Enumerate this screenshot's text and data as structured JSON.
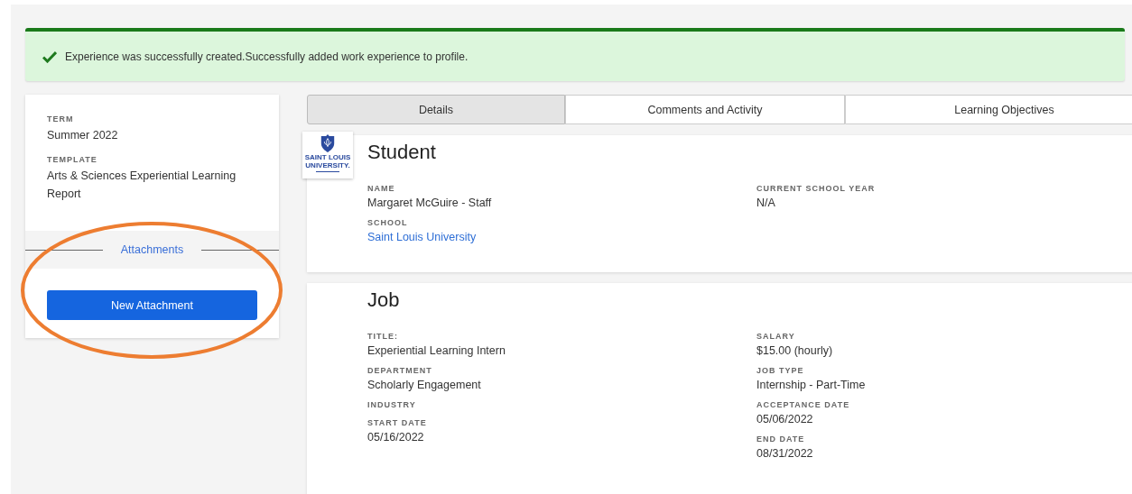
{
  "alert": {
    "kind": "success",
    "message": "Experience was successfully created.Successfully added work experience to profile."
  },
  "sidebar": {
    "fields": [
      {
        "label": "TERM",
        "value": "Summer 2022"
      },
      {
        "label": "TEMPLATE",
        "value": "Arts & Sciences Experiential Learning Report"
      }
    ],
    "section_title": "Attachments",
    "button": "New Attachment"
  },
  "annotation": {
    "kind": "ellipse",
    "color": "#ed7d31"
  },
  "tabs": [
    {
      "label": "Details",
      "selected": true
    },
    {
      "label": "Comments and Activity",
      "selected": false
    },
    {
      "label": "Learning Objectives",
      "selected": false
    }
  ],
  "logo": {
    "lines": [
      "SAINT LOUIS",
      "UNIVERSITY."
    ]
  },
  "sections": [
    {
      "title": "Student",
      "columns": [
        [
          {
            "label": "NAME",
            "value": "Margaret McGuire - Staff"
          },
          {
            "label": "SCHOOL",
            "value": "Saint Louis University",
            "link": true
          }
        ],
        [
          {
            "label": "CURRENT SCHOOL YEAR",
            "value": "N/A"
          }
        ]
      ]
    },
    {
      "title": "Job",
      "columns": [
        [
          {
            "label": "TITLE:",
            "value": "Experiential Learning Intern"
          },
          {
            "label": "DEPARTMENT",
            "value": "Scholarly Engagement"
          },
          {
            "label": "INDUSTRY"
          },
          {
            "label": "START DATE",
            "value": "05/16/2022"
          }
        ],
        [
          {
            "label": "SALARY",
            "value": "$15.00 (hourly)"
          },
          {
            "label": "JOB TYPE",
            "value": "Internship - Part-Time"
          },
          {
            "label": "ACCEPTANCE DATE",
            "value": "05/06/2022"
          },
          {
            "label": "END DATE",
            "value": "08/31/2022"
          }
        ]
      ]
    }
  ]
}
